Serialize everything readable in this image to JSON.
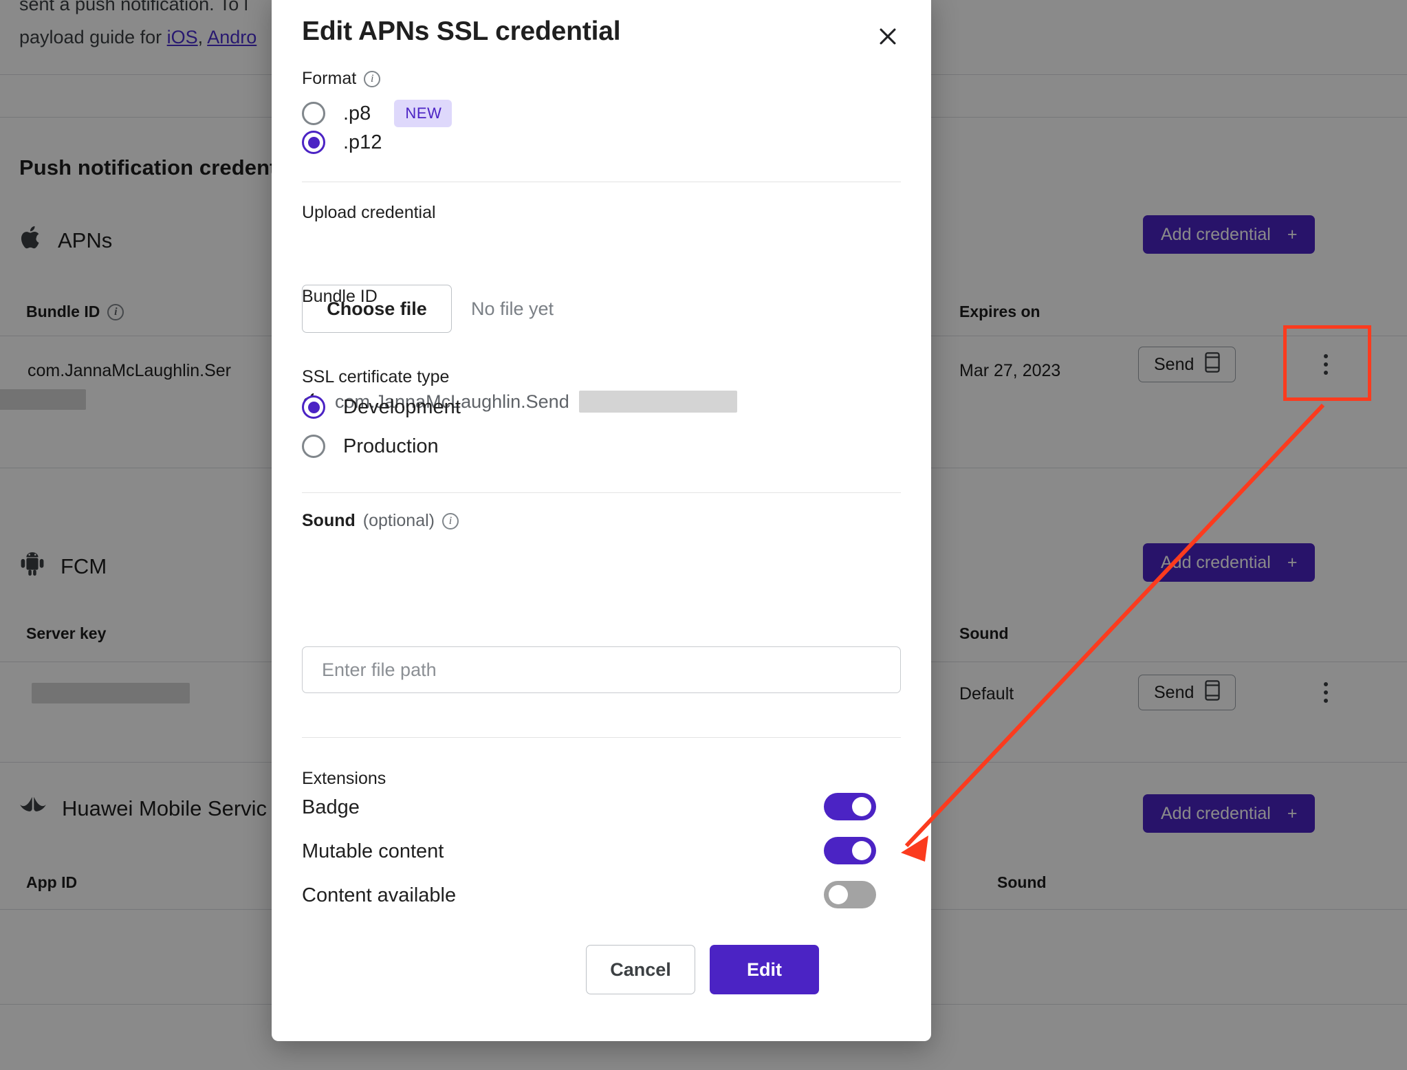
{
  "background": {
    "intro_line1": "sent a push notification. To l",
    "intro_prefix": "payload guide for ",
    "link_ios": "iOS",
    "intro_comma": ", ",
    "link_android": "Andro",
    "section_title": "Push notification credent",
    "providers": [
      {
        "icon": "apple-icon",
        "name": "APNs"
      },
      {
        "icon": "android-icon",
        "name": "FCM"
      },
      {
        "icon": "huawei-icon",
        "name": "Huawei Mobile Servic"
      }
    ],
    "add_credential_label": "Add credential",
    "add_credential_plus": "+",
    "columns": {
      "bundle_id": "Bundle ID",
      "expires_on": "Expires on",
      "server_key": "Server key",
      "sound": "Sound",
      "app_id": "App ID"
    },
    "rows": {
      "apns_bundle_id": "com.JannaMcLaughlin.Ser",
      "apns_expires_on": "Mar 27, 2023",
      "fcm_server_key_prefix": "",
      "fcm_sound": "Default"
    },
    "send_label": "Send",
    "send_icon": "phone-icon",
    "kebab_icon": "more-vertical-icon"
  },
  "annotation": {
    "box_color": "#fb3b1e",
    "arrow_color": "#fb3b1e",
    "target": "more-vertical-icon"
  },
  "modal": {
    "title": "Edit APNs SSL credential",
    "close_icon": "close-icon",
    "format": {
      "label": "Format",
      "info_icon": "info-icon",
      "options": [
        {
          "value": ".p8",
          "selected": false,
          "badge": "NEW"
        },
        {
          "value": ".p12",
          "selected": true,
          "badge": null
        }
      ]
    },
    "upload": {
      "label": "Upload credential",
      "button_label": "Choose file",
      "status": "No file yet"
    },
    "bundle": {
      "label": "Bundle ID",
      "icon": "apple-icon",
      "value": "com.JannaMcLaughlin.Send"
    },
    "ssl_cert_type": {
      "label": "SSL certificate type",
      "options": [
        {
          "value": "Development",
          "selected": true
        },
        {
          "value": "Production",
          "selected": false
        }
      ]
    },
    "sound": {
      "label": "Sound",
      "optional_text": "(optional)",
      "info_icon": "info-icon",
      "value": "",
      "placeholder": "Enter file path"
    },
    "extensions": {
      "label": "Extensions",
      "items": [
        {
          "label": "Badge",
          "on": true
        },
        {
          "label": "Mutable content",
          "on": true
        },
        {
          "label": "Content available",
          "on": false
        }
      ]
    },
    "actions": {
      "cancel_label": "Cancel",
      "submit_label": "Edit"
    },
    "colors": {
      "accent": "#4b23c4",
      "badge_bg": "#ded8fb",
      "toggle_off": "#a3a3a3"
    }
  }
}
